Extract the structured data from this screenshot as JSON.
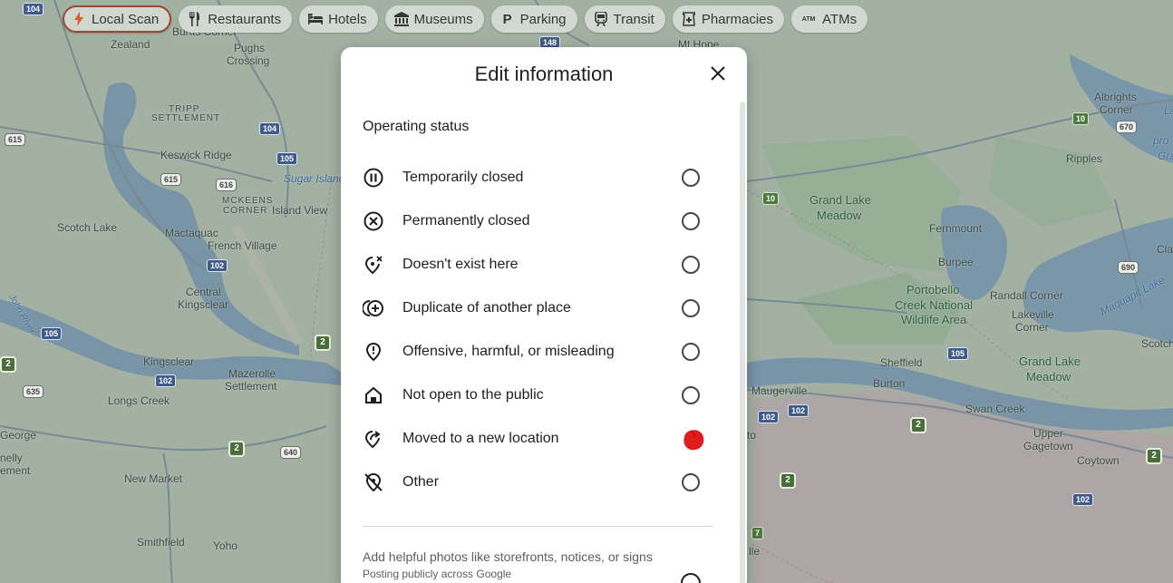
{
  "chips": [
    {
      "label": "Local Scan",
      "icon": "bolt-icon"
    },
    {
      "label": "Restaurants",
      "icon": "fork-knife-icon"
    },
    {
      "label": "Hotels",
      "icon": "bed-icon"
    },
    {
      "label": "Museums",
      "icon": "museum-icon"
    },
    {
      "label": "Parking",
      "icon": "parking-icon"
    },
    {
      "label": "Transit",
      "icon": "train-icon"
    },
    {
      "label": "Pharmacies",
      "icon": "pharmacy-icon"
    },
    {
      "label": "ATMs",
      "icon": "atm-icon"
    }
  ],
  "map": {
    "places": {
      "zealand": "Zealand",
      "burtts_corner": "Burtts Corner",
      "pughs_crossing_1": "Pughs",
      "pughs_crossing_2": "Crossing",
      "mt_hope": "Mt Hope",
      "tripp_settlement_1": "TRIPP",
      "tripp_settlement_2": "SETTLEMENT",
      "keswick_ridge": "Keswick Ridge",
      "sugar_island": "Sugar Island",
      "mckeens_corner_1": "MCKEENS",
      "mckeens_corner_2": "CORNER",
      "island_view": "Island View",
      "scotch_lake": "Scotch Lake",
      "mactaquac": "Mactaquac",
      "french_village": "French Village",
      "central_kingsclear_1": "Central",
      "central_kingsclear_2": "Kingsclear",
      "kingsclear": "Kingsclear",
      "mazerolle_1": "Mazerolle",
      "mazerolle_2": "Settlement",
      "longs_creek": "Longs Creek",
      "george": "George",
      "nelly": "nelly",
      "ement": "ement",
      "new_market": "New Market",
      "smithfield": "Smithfield",
      "yoho": "Yoho",
      "grand_lake_meadow_1": "Grand Lake",
      "grand_lake_meadow_2": "Meadow",
      "albrights_1": "Albrights",
      "albrights_2": "Corner",
      "ripples": "Ripples",
      "fernmount": "Fernmount",
      "burpee": "Burpee",
      "portobello_1": "Portobello",
      "portobello_2": "Creek National",
      "portobello_3": "Wildlife Area",
      "randall_corner": "Randall Corner",
      "lakeville_1": "Lakeville",
      "lakeville_2": "Corner",
      "maquapit_lake": "Maquapit Lake",
      "sheffield": "Sheffield",
      "burton": "Burton",
      "maugerville": "Maugerville",
      "grand_lake_meadow_b1": "Grand Lake",
      "grand_lake_meadow_b2": "Meadow",
      "swan_creek": "Swan Creek",
      "upper_gagetown_1": "Upper",
      "upper_gagetown_2": "Gagetown",
      "coytown": "Coytown",
      "scotch_r": "Scotch",
      "cla": "Cla",
      "to": "to",
      "lle": "lle",
      "river": "John River",
      "la": "La",
      "pro": "pro",
      "gra": "Gra"
    },
    "shields": {
      "s104a": "104",
      "s148": "148",
      "s615a": "615",
      "s104b": "104",
      "s105a": "105",
      "s615b": "615",
      "s616": "616",
      "s102a": "102",
      "s105b": "105",
      "s102b": "102",
      "s635": "635",
      "s640": "640",
      "s10a": "10",
      "s670": "670",
      "s10b": "10",
      "s690": "690",
      "s105c": "105",
      "s102c": "102",
      "s102d": "102",
      "s102e": "102",
      "s7": "7"
    }
  },
  "dialog": {
    "title": "Edit information",
    "section_title": "Operating status",
    "options": [
      {
        "label": "Temporarily closed",
        "icon": "pause-circle-icon",
        "selected": false
      },
      {
        "label": "Permanently closed",
        "icon": "x-circle-icon",
        "selected": false
      },
      {
        "label": "Doesn't exist here",
        "icon": "pin-x-icon",
        "selected": false
      },
      {
        "label": "Duplicate of another place",
        "icon": "duplicate-icon",
        "selected": false
      },
      {
        "label": "Offensive, harmful, or misleading",
        "icon": "pin-alert-icon",
        "selected": false
      },
      {
        "label": "Not open to the public",
        "icon": "house-icon",
        "selected": false
      },
      {
        "label": "Moved to a new location",
        "icon": "pin-arrow-icon",
        "selected": true
      },
      {
        "label": "Other",
        "icon": "pin-off-icon",
        "selected": false
      }
    ],
    "photos_text": "Add helpful photos like storefronts, notices, or signs",
    "photos_sub": "Posting publicly across Google"
  },
  "colors": {
    "mark": "#e01c1c",
    "chip_active_border": "#9a4b2f"
  }
}
